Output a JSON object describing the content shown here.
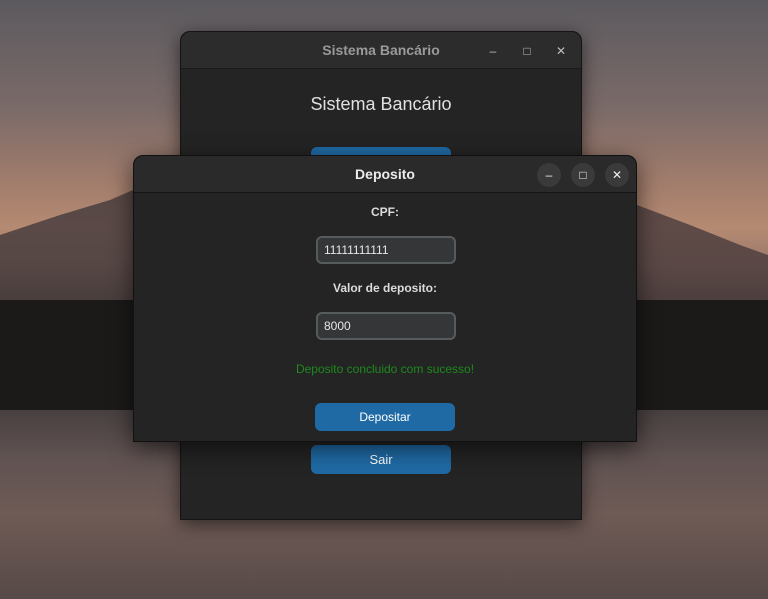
{
  "main_window": {
    "title": "Sistema Bancário",
    "heading": "Sistema Bancário",
    "exit_label": "Sair",
    "controls": [
      "minimize-icon",
      "maximize-icon",
      "close-icon"
    ]
  },
  "dialog": {
    "title": "Deposito",
    "cpf_label": "CPF:",
    "cpf_value": "11111111111",
    "amount_label": "Valor de deposito:",
    "amount_value": "8000",
    "status_message": "Deposito concluido com sucesso!",
    "submit_label": "Depositar",
    "controls": [
      "minimize-icon",
      "maximize-icon",
      "close-icon"
    ]
  },
  "colors": {
    "accent": "#1f6aa5",
    "success": "#1d8a1d",
    "window_bg": "#242424"
  }
}
